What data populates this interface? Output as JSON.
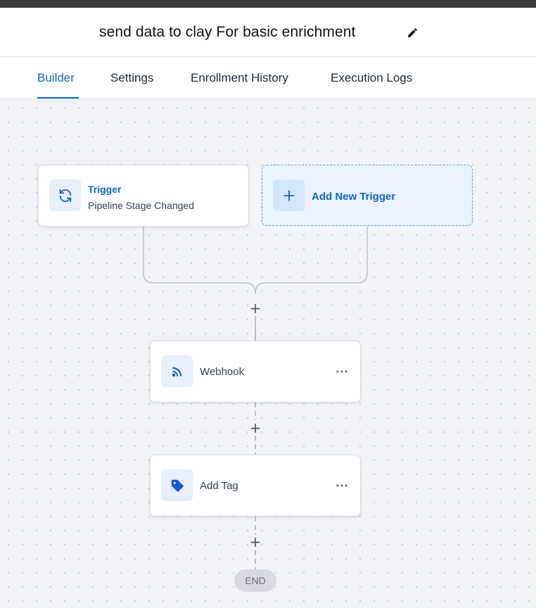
{
  "workflow": {
    "title": "send data to clay For basic enrichment"
  },
  "tabs": [
    {
      "label": "Builder",
      "active": true
    },
    {
      "label": "Settings",
      "active": false
    },
    {
      "label": "Enrollment History",
      "active": false
    },
    {
      "label": "Execution Logs",
      "active": false
    }
  ],
  "trigger": {
    "title": "Trigger",
    "subtitle": "Pipeline Stage Changed",
    "icon": "refresh-icon"
  },
  "add_trigger": {
    "label": "Add New Trigger",
    "icon": "plus-icon"
  },
  "actions": [
    {
      "label": "Webhook",
      "icon": "webhook-icon"
    },
    {
      "label": "Add Tag",
      "icon": "tag-icon"
    }
  ],
  "add_step_symbol": "+",
  "end_label": "END",
  "colors": {
    "accent": "#1565c0",
    "canvas": "#f1f3f7",
    "icon_bg": "#e8effa"
  }
}
